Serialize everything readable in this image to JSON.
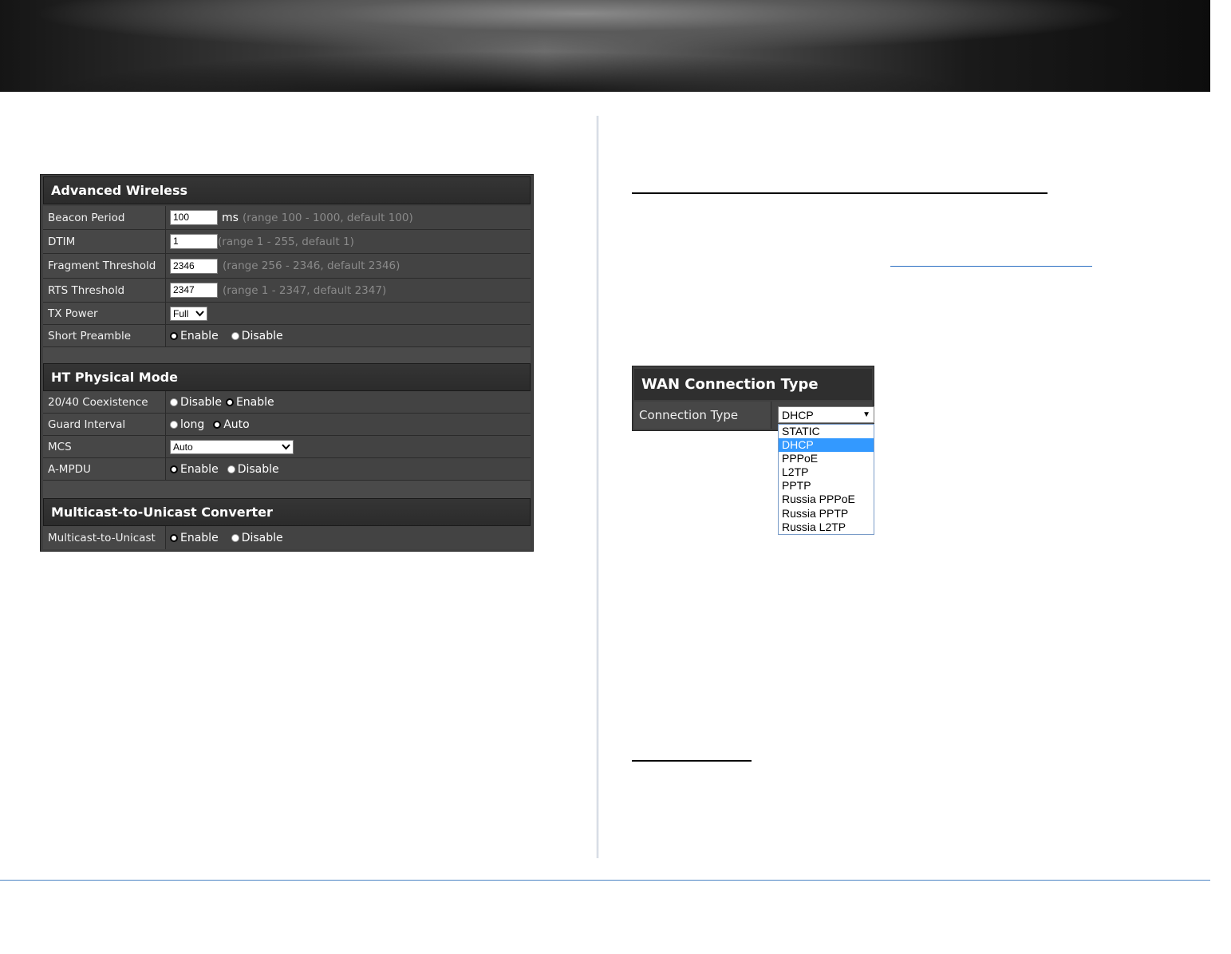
{
  "advanced_wireless": {
    "title": "Advanced Wireless",
    "rows": {
      "beacon": {
        "label": "Beacon Period",
        "value": "100",
        "unit": "ms",
        "hint": "(range 100 - 1000, default 100)"
      },
      "dtim": {
        "label": "DTIM",
        "value": "1",
        "hint": "(range 1 - 255, default 1)"
      },
      "fragment": {
        "label": "Fragment Threshold",
        "value": "2346",
        "hint": "(range 256 - 2346, default 2346)"
      },
      "rts": {
        "label": "RTS Threshold",
        "value": "2347",
        "hint": "(range 1 - 2347, default 2347)"
      },
      "tx_power": {
        "label": "TX Power",
        "value": "Full"
      },
      "short_preamble": {
        "label": "Short Preamble",
        "opt1": "Enable",
        "opt2": "Disable",
        "selected": "Enable"
      }
    }
  },
  "ht_physical": {
    "title": "HT Physical Mode",
    "rows": {
      "coexistence": {
        "label": "20/40 Coexistence",
        "opt1": "Disable",
        "opt2": "Enable",
        "selected": "Enable"
      },
      "guard": {
        "label": "Guard Interval",
        "opt1": "long",
        "opt2": "Auto",
        "selected": "Auto"
      },
      "mcs": {
        "label": "MCS",
        "value": "Auto"
      },
      "ampdu": {
        "label": "A-MPDU",
        "opt1": "Enable",
        "opt2": "Disable",
        "selected": "Enable"
      }
    }
  },
  "multicast": {
    "title": "Multicast-to-Unicast Converter",
    "rows": {
      "m2u": {
        "label": "Multicast-to-Unicast",
        "opt1": "Enable",
        "opt2": "Disable",
        "selected": "Enable"
      }
    }
  },
  "wan": {
    "title": "WAN Connection Type",
    "label": "Connection Type",
    "selected": "DHCP",
    "arrow": "▼",
    "options": [
      "STATIC",
      "DHCP",
      "PPPoE",
      "L2TP",
      "PPTP",
      "Russia PPPoE",
      "Russia PPTP",
      "Russia L2TP"
    ]
  },
  "colors": {
    "panel_bg": "#3f3f3f",
    "highlight": "#3399ff",
    "link_rule": "#2b6fc2",
    "footer_rule": "#4a83c3"
  }
}
